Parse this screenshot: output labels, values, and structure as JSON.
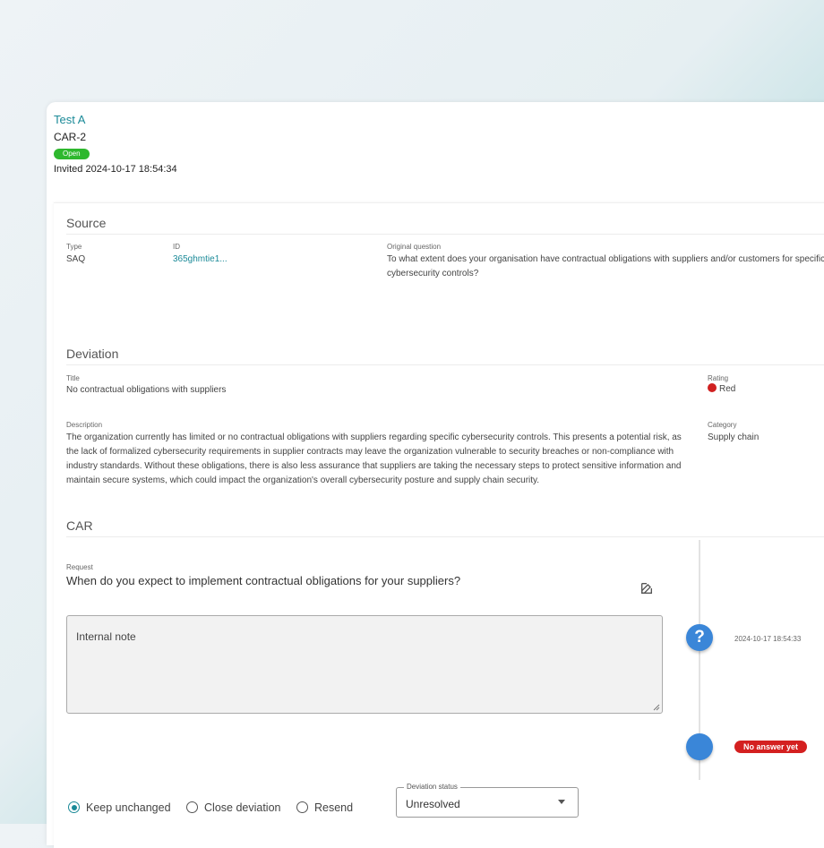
{
  "header": {
    "title": "Test A",
    "car_id": "CAR-2",
    "status": "Open",
    "invited": "Invited 2024-10-17 18:54:34"
  },
  "source": {
    "section_title": "Source",
    "type_label": "Type",
    "type_value": "SAQ",
    "id_label": "ID",
    "id_value": "365ghmtie1...",
    "question_label": "Original question",
    "question_value": "To what extent does your organisation have contractual obligations with suppliers and/or customers for specific cybersecurity controls?"
  },
  "deviation": {
    "section_title": "Deviation",
    "title_label": "Title",
    "title_value": "No contractual obligations with suppliers",
    "rating_label": "Rating",
    "rating_value": "Red",
    "rating_color": "#d02020",
    "description_label": "Description",
    "description_value": "The organization currently has limited or no contractual obligations with suppliers regarding specific cybersecurity controls. This presents a potential risk, as the lack of formalized cybersecurity requirements in supplier contracts may leave the organization vulnerable to security breaches or non-compliance with industry standards. Without these obligations, there is also less assurance that suppliers are taking the necessary steps to protect sensitive information and maintain secure systems, which could impact the organization's overall cybersecurity posture and supply chain security.",
    "category_label": "Category",
    "category_value": "Supply chain"
  },
  "car": {
    "section_title": "CAR",
    "request_label": "Request",
    "request_value": "When do you expect to implement contractual obligations for your suppliers?",
    "internal_note_placeholder": "Internal note",
    "timeline": {
      "question_time": "2024-10-17 18:54:33",
      "no_answer_label": "No answer yet"
    },
    "actions": {
      "keep_unchanged": "Keep unchanged",
      "close_deviation": "Close deviation",
      "resend": "Resend",
      "selected": "keep_unchanged"
    },
    "deviation_status": {
      "label": "Deviation status",
      "value": "Unresolved"
    }
  },
  "colors": {
    "accent": "#1b8a98",
    "open_badge": "#2eb82e",
    "timeline_blue": "#3a86d8",
    "no_answer_red": "#d42020"
  },
  "icons": {
    "edit": "edit-icon",
    "question": "question-icon"
  }
}
